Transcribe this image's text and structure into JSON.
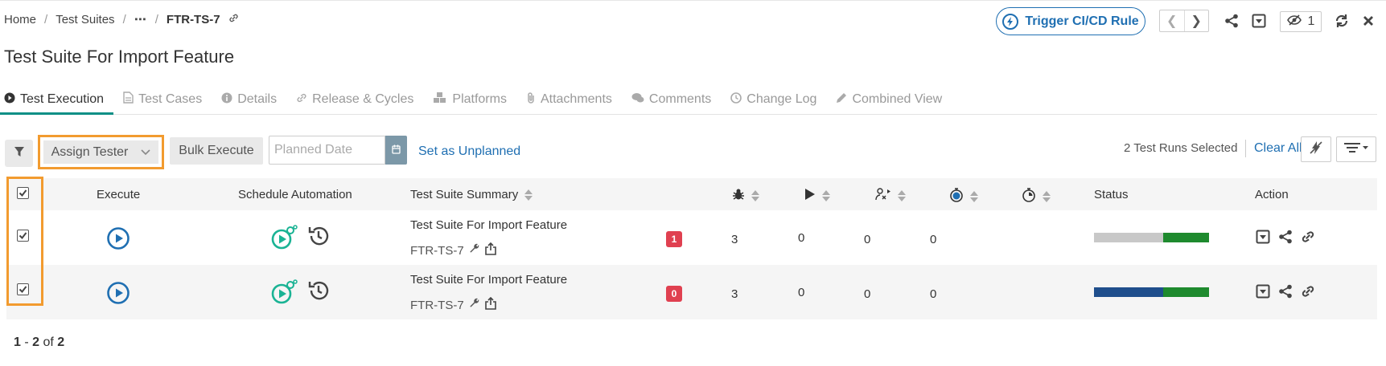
{
  "breadcrumb": {
    "home": "Home",
    "suites": "Test Suites",
    "ellipsis": "⋯",
    "current": "FTR-TS-7"
  },
  "header": {
    "trigger_label": "Trigger CI/CD Rule",
    "watch_count": "1"
  },
  "page_title": "Test Suite For Import Feature",
  "tabs": [
    {
      "label": "Test Execution",
      "icon": "play-circle-icon",
      "active": true
    },
    {
      "label": "Test Cases",
      "icon": "document-icon"
    },
    {
      "label": "Details",
      "icon": "info-icon"
    },
    {
      "label": "Release & Cycles",
      "icon": "link-icon"
    },
    {
      "label": "Platforms",
      "icon": "cubes-icon"
    },
    {
      "label": "Attachments",
      "icon": "paperclip-icon"
    },
    {
      "label": "Comments",
      "icon": "comments-icon"
    },
    {
      "label": "Change Log",
      "icon": "clock-icon"
    },
    {
      "label": "Combined View",
      "icon": "pencil-icon"
    }
  ],
  "toolbar": {
    "assign_label": "Assign Tester",
    "bulk_label": "Bulk Execute",
    "date_placeholder": "Planned Date",
    "unplanned_label": "Set as Unplanned",
    "selected_text": "2 Test Runs Selected",
    "clear_all": "Clear All"
  },
  "table": {
    "headers": {
      "execute": "Execute",
      "schedule": "Schedule Automation",
      "summary": "Test Suite Summary",
      "status": "Status",
      "action": "Action"
    },
    "rows": [
      {
        "title": "Test Suite For Import Feature",
        "id": "FTR-TS-7",
        "bugs": "1",
        "executions": "3",
        "assigned": "0",
        "col7": "0",
        "col8": "0",
        "status": {
          "grey": 0.6,
          "green": 0.4
        }
      },
      {
        "title": "Test Suite For Import Feature",
        "id": "FTR-TS-7",
        "bugs": "0",
        "executions": "3",
        "assigned": "0",
        "col7": "0",
        "col8": "0",
        "status": {
          "blue": 0.6,
          "green": 0.4
        }
      }
    ]
  },
  "pagination": {
    "from": "1",
    "to": "2",
    "of_label": "of",
    "total": "2"
  },
  "colors": {
    "accent": "#1f6fb2",
    "teal": "#0d8f86",
    "highlight": "#f29b2f",
    "bug": "#e04050",
    "pass": "#1e8a2e",
    "blocked": "#1f4e8c",
    "unexecuted": "#c8c8c8"
  }
}
